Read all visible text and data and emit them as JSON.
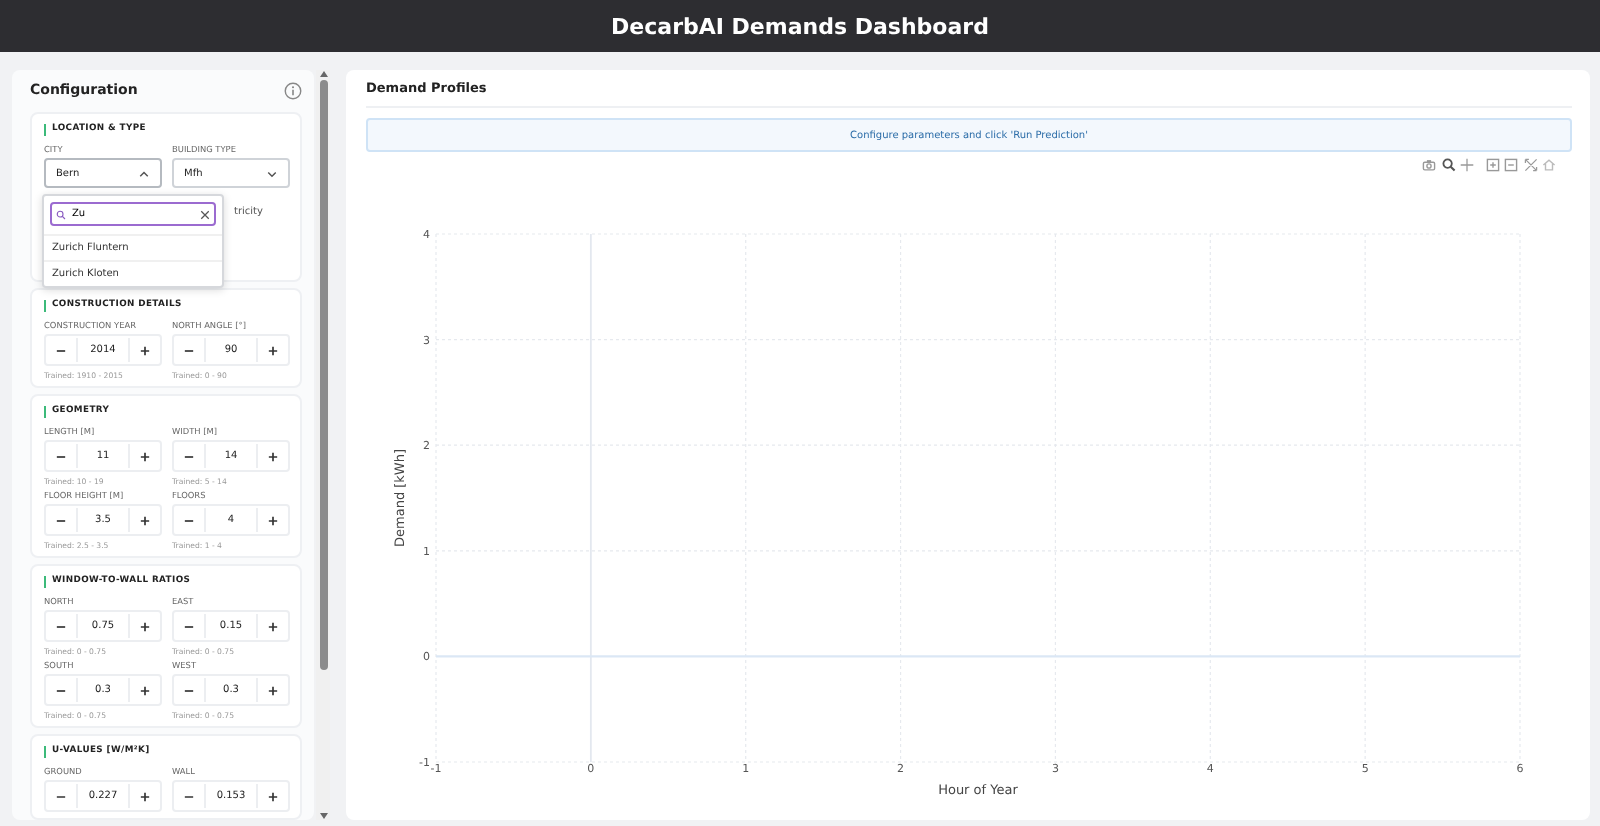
{
  "header": {
    "title": "DecarbAI Demands Dashboard"
  },
  "sidebar": {
    "title": "Configuration",
    "location": {
      "title": "LOCATION & TYPE",
      "city": {
        "label": "CITY",
        "value": "Bern",
        "expanded": true
      },
      "building_type": {
        "label": "BUILDING TYPE",
        "value": "Mfh",
        "expanded": false
      },
      "partial_text": "tricity",
      "dropdown": {
        "search": "Zu",
        "options": [
          "Zurich Fluntern",
          "Zurich Kloten"
        ]
      }
    },
    "sections": [
      {
        "title": "CONSTRUCTION DETAILS",
        "fields": [
          {
            "label": "CONSTRUCTION YEAR",
            "value": "2014",
            "note": "Trained: 1910 - 2015"
          },
          {
            "label": "NORTH ANGLE [°]",
            "value": "90",
            "note": "Trained: 0 - 90"
          }
        ]
      },
      {
        "title": "GEOMETRY",
        "fields": [
          {
            "label": "LENGTH [M]",
            "value": "11",
            "note": "Trained: 10 - 19"
          },
          {
            "label": "WIDTH [M]",
            "value": "14",
            "note": "Trained: 5 - 14"
          },
          {
            "label": "FLOOR HEIGHT [M]",
            "value": "3.5",
            "note": "Trained: 2.5 - 3.5"
          },
          {
            "label": "FLOORS",
            "value": "4",
            "note": "Trained: 1 - 4"
          }
        ]
      },
      {
        "title": "WINDOW-TO-WALL RATIOS",
        "fields": [
          {
            "label": "NORTH",
            "value": "0.75",
            "note": "Trained: 0 - 0.75"
          },
          {
            "label": "EAST",
            "value": "0.15",
            "note": "Trained: 0 - 0.75"
          },
          {
            "label": "SOUTH",
            "value": "0.3",
            "note": "Trained: 0 - 0.75"
          },
          {
            "label": "WEST",
            "value": "0.3",
            "note": "Trained: 0 - 0.75"
          }
        ]
      },
      {
        "title": "U-VALUES [W/M²K]",
        "fields": [
          {
            "label": "GROUND",
            "value": "0.227"
          },
          {
            "label": "WALL",
            "value": "0.153"
          }
        ]
      }
    ]
  },
  "main": {
    "title": "Demand Profiles",
    "banner": "Configure parameters and click 'Run Prediction'",
    "chart_data": {
      "type": "line",
      "grid": true,
      "xlabel": "Hour of Year",
      "ylabel": "Demand [kWh]",
      "xlim": [
        -1,
        6
      ],
      "ylim": [
        -1,
        4
      ],
      "xticks": [
        -1,
        0,
        1,
        2,
        3,
        4,
        5,
        6
      ],
      "yticks": [
        -1,
        0,
        1,
        2,
        3,
        4
      ]
    }
  }
}
